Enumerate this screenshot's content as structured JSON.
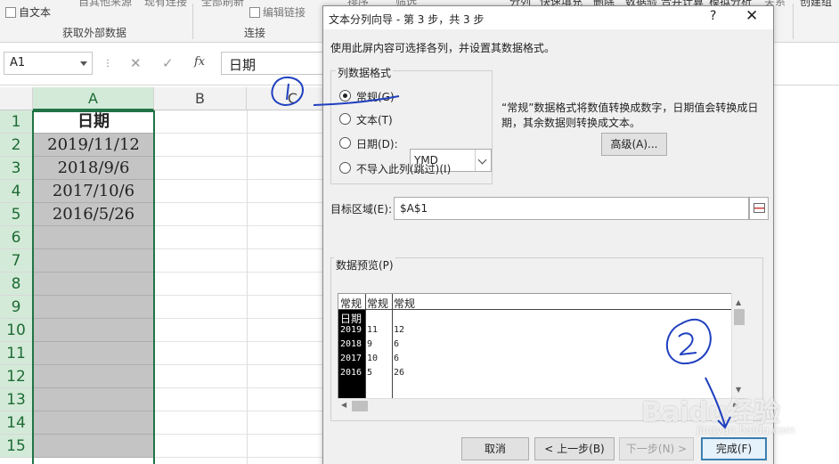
{
  "ribbon": {
    "partial_top_labels": [
      "自其他来源",
      "现有连接",
      "全部刷新",
      "排序",
      "筛选",
      "分列",
      "快速填充",
      "删除",
      "数据验",
      "合并计算",
      "模拟分析",
      "关系",
      "创建组"
    ],
    "from_text_label": "自文本",
    "edit_links_label": "编辑链接",
    "group_get_external": "获取外部数据",
    "group_connections": "连接"
  },
  "formula_bar": {
    "name_box": "A1",
    "cancel_icon": "✕",
    "enter_icon": "✓",
    "fx_label": "fx",
    "formula_value": "日期"
  },
  "sheet": {
    "columns": [
      "A",
      "B",
      "C"
    ],
    "rows": [
      "1",
      "2",
      "3",
      "4",
      "5",
      "6",
      "7",
      "8",
      "9",
      "10",
      "11",
      "12",
      "13",
      "14",
      "15"
    ],
    "column_a_values": [
      "日期",
      "2019/11/12",
      "2018/9/6",
      "2017/10/6",
      "2016/5/26",
      "",
      "",
      "",
      "",
      "",
      "",
      "",
      "",
      "",
      ""
    ]
  },
  "dialog": {
    "title": "文本分列向导 - 第 3 步，共 3 步",
    "help_icon": "?",
    "close_icon": "✕",
    "instruction": "使用此屏内容可选择各列，并设置其数据格式。",
    "format_group_label": "列数据格式",
    "radio_general": "常规(G)",
    "radio_text": "文本(T)",
    "radio_date": "日期(D):",
    "date_format_value": "YMD",
    "radio_skip": "不导入此列(跳过)(I)",
    "selected_format": "常规(G)",
    "general_desc_line1": "“常规”数据格式将数值转换成数字，日期值会转换成日",
    "general_desc_line2": "期，其余数据则转换成文本。",
    "advanced_button": "高级(A)...",
    "destination_label": "目标区域(E):",
    "destination_value": "$A$1",
    "preview_label": "数据预览(P)",
    "preview_headers": [
      "常规",
      "常规",
      "常规"
    ],
    "preview_rows": [
      [
        "日期",
        "",
        ""
      ],
      [
        "2019",
        "11",
        "12"
      ],
      [
        "2018",
        "9",
        "6"
      ],
      [
        "2017",
        "10",
        "6"
      ],
      [
        "2016",
        "5",
        "26"
      ]
    ],
    "btn_cancel": "取消",
    "btn_back": "< 上一步(B)",
    "btn_next": "下一步(N) >",
    "btn_finish": "完成(F)"
  },
  "watermark": {
    "brand": "Baidu经验",
    "url": "jingyan.baidu.com"
  },
  "annotations": {
    "mark_1": "①",
    "mark_2": "②",
    "stroke_color": "#1f3fbf"
  }
}
